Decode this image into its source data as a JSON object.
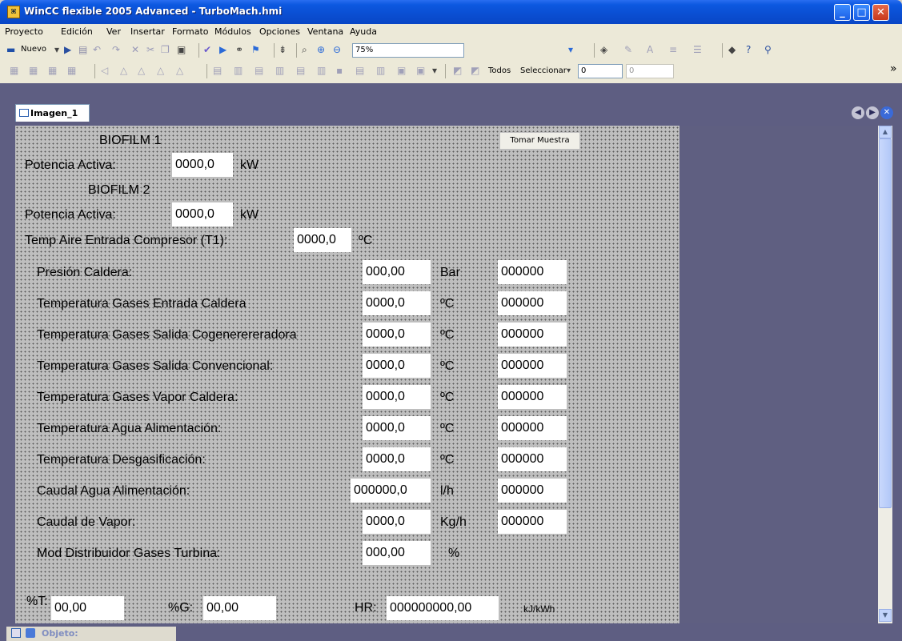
{
  "window": {
    "title": "WinCC flexible 2005 Advanced - TurboMach.hmi"
  },
  "menu": [
    "Proyecto",
    "Edición",
    "Ver",
    "Insertar",
    "Formato",
    "Módulos",
    "Opciones",
    "Ventana",
    "Ayuda"
  ],
  "toolbar": {
    "new_label": "Nuevo",
    "zoom": "75%",
    "all_label": "Todos",
    "select_label": "Seleccionar",
    "select_value": "0",
    "spin_value": "0"
  },
  "tab": {
    "label": "Imagen_1"
  },
  "screen": {
    "biofilm1_title": "BIOFILM 1",
    "biofilm2_title": "BIOFILM 2",
    "button_label": "Tomar Muestra",
    "power_label": "Potencia Activa:",
    "power1_value": "0000,0",
    "power2_value": "0000,0",
    "power_unit": "kW",
    "t1_label": "Temp Aire Entrada Compresor (T1):",
    "t1_value": "0000,0",
    "t1_unit": "ºC",
    "rows": [
      {
        "label": "Presión Caldera:",
        "value": "000,00",
        "unit": "Bar",
        "extra": "000000"
      },
      {
        "label": "Temperatura Gases Entrada Caldera",
        "value": "0000,0",
        "unit": "ºC",
        "extra": "000000"
      },
      {
        "label": "Temperatura Gases Salida Cogenerereradora",
        "value": "0000,0",
        "unit": "ºC",
        "extra": "000000"
      },
      {
        "label": "Temperatura Gases Salida Convencional:",
        "value": "0000,0",
        "unit": "ºC",
        "extra": "000000"
      },
      {
        "label": "Temperatura Gases Vapor Caldera:",
        "value": "0000,0",
        "unit": "ºC",
        "extra": "000000"
      },
      {
        "label": "Temperatura Agua Alimentación:",
        "value": "0000,0",
        "unit": "ºC",
        "extra": "000000"
      },
      {
        "label": "Temperatura Desgasificación:",
        "value": "0000,0",
        "unit": "ºC",
        "extra": "000000"
      },
      {
        "label": "Caudal Agua Alimentación:",
        "value": "000000,0",
        "unit": "l/h",
        "extra": "000000"
      },
      {
        "label": "Caudal de Vapor:",
        "value": "0000,0",
        "unit": "Kg/h",
        "extra": "000000"
      },
      {
        "label": "Mod Distribuidor Gases Turbina:",
        "value": "000,00",
        "unit": "%",
        "extra": ""
      }
    ],
    "pt_label": "%T:",
    "pt_value": "00,00",
    "pg_label": "%G:",
    "pg_value": "00,00",
    "hr_label": "HR:",
    "hr_value": "000000000,00",
    "hr_unit": "kJ/kWh"
  },
  "status": {
    "label": "Objeto:"
  }
}
